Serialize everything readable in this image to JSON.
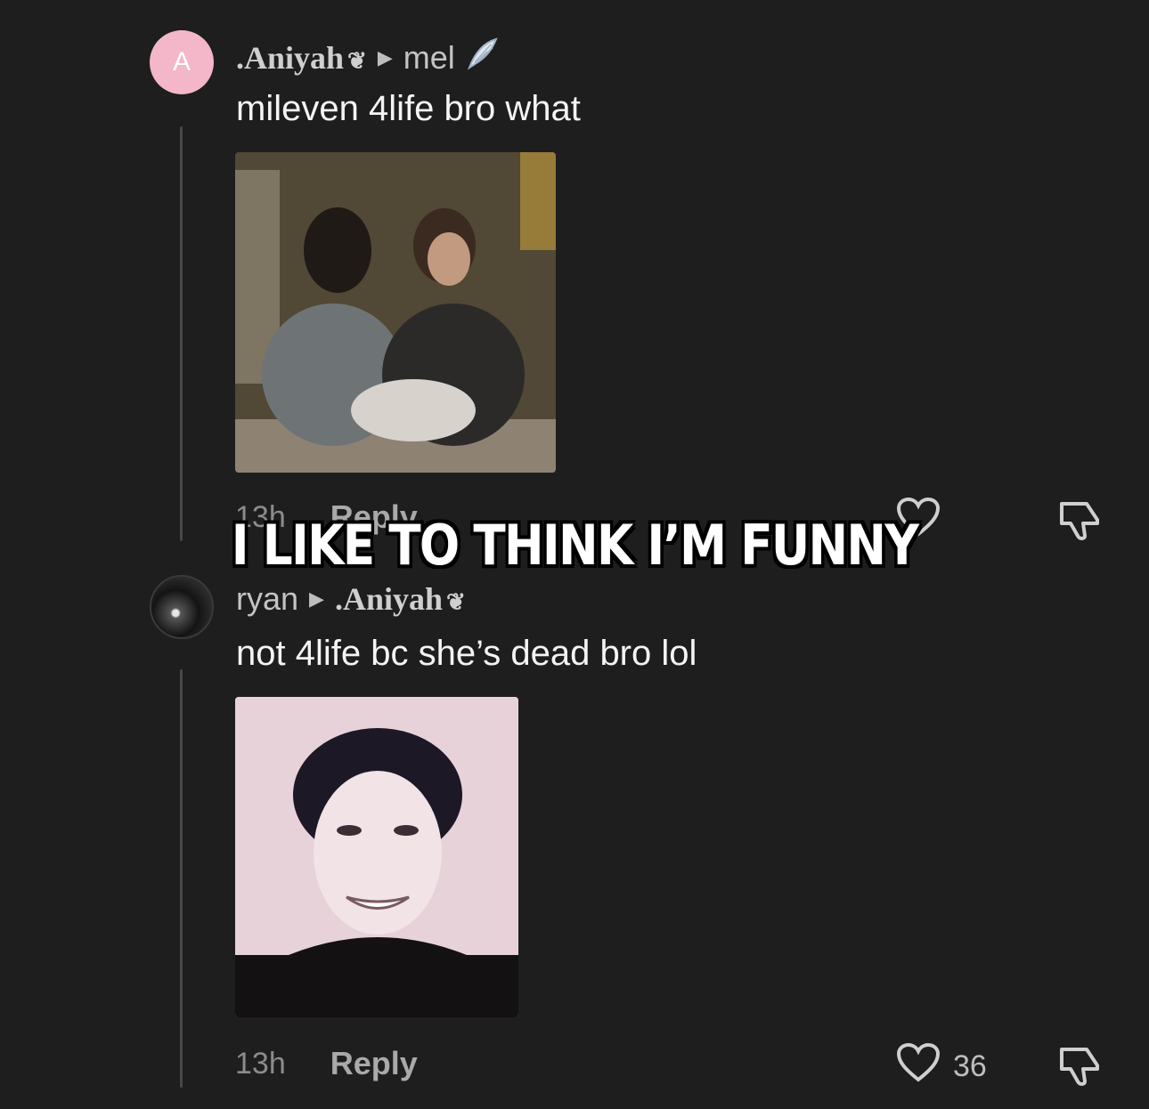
{
  "comments": [
    {
      "avatar_letter": "A",
      "author": ".Aniyah",
      "author_suffix": "❦",
      "reply_to": "mel",
      "reply_to_icon": "wing-icon",
      "text": "mileven 4life bro what",
      "time": "13h",
      "reply_label": "Reply",
      "like_count": ""
    },
    {
      "author": "ryan",
      "reply_to": ".Aniyah",
      "reply_to_suffix": "❦",
      "text": "not 4life bc she’s dead bro lol",
      "time": "13h",
      "reply_label": "Reply",
      "like_count": "36"
    }
  ],
  "overlay": {
    "caption": "I LIKE TO THINK I’M FUNNY"
  },
  "colors": {
    "background": "#1e1e1e",
    "avatar_pink": "#f3b7c9"
  }
}
